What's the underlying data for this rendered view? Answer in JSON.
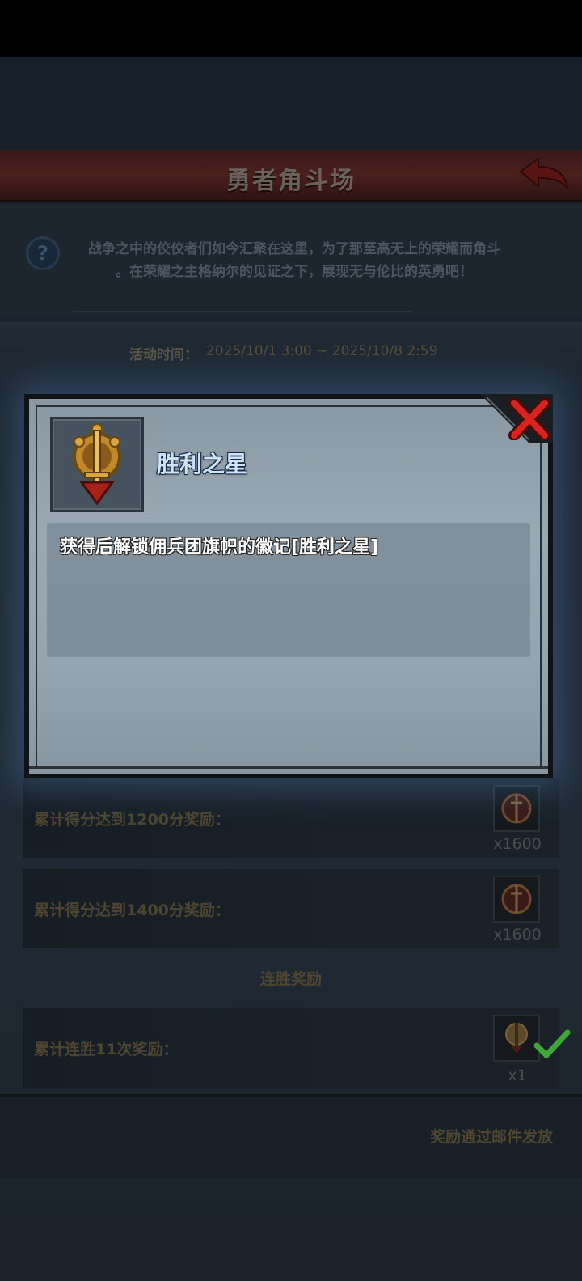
{
  "header": {
    "title": "勇者角斗场"
  },
  "intro": {
    "help_icon_text": "?",
    "description_line1": "战争之中的佼佼者们如今汇聚在这里，为了那至高无上的荣耀而角斗",
    "description_line2": "。在荣耀之主格纳尔的见证之下，展现无与伦比的英勇吧！"
  },
  "event": {
    "time_label": "活动时间：",
    "time_value": "2025/10/1 3:00 ~ 2025/10/8 2:59"
  },
  "rewards": [
    {
      "label": "累计得分达到1200分奖励：",
      "icon": "medal-icon",
      "count": "x1600"
    },
    {
      "label": "累计得分达到1400分奖励：",
      "icon": "medal-icon",
      "count": "x1600"
    }
  ],
  "streak_section": {
    "title": "连胜奖励",
    "rows": [
      {
        "label": "累计连胜11次奖励：",
        "icon": "emblem-icon",
        "count": "x1",
        "claimed": true
      }
    ]
  },
  "footer": {
    "note": "奖励通过邮件发放"
  },
  "modal": {
    "item_name": "胜利之星",
    "item_icon": "sword-emblem-icon",
    "item_description": "获得后解锁佣兵团旗帜的徽记[胜利之星]",
    "close_icon": "close-icon"
  },
  "colors": {
    "title_bar": "#4a1f1c",
    "modal_bg": "#9aa8b3",
    "item_name": "#cde4ff",
    "close_red": "#d8231e",
    "check_green": "#3fa63a"
  }
}
